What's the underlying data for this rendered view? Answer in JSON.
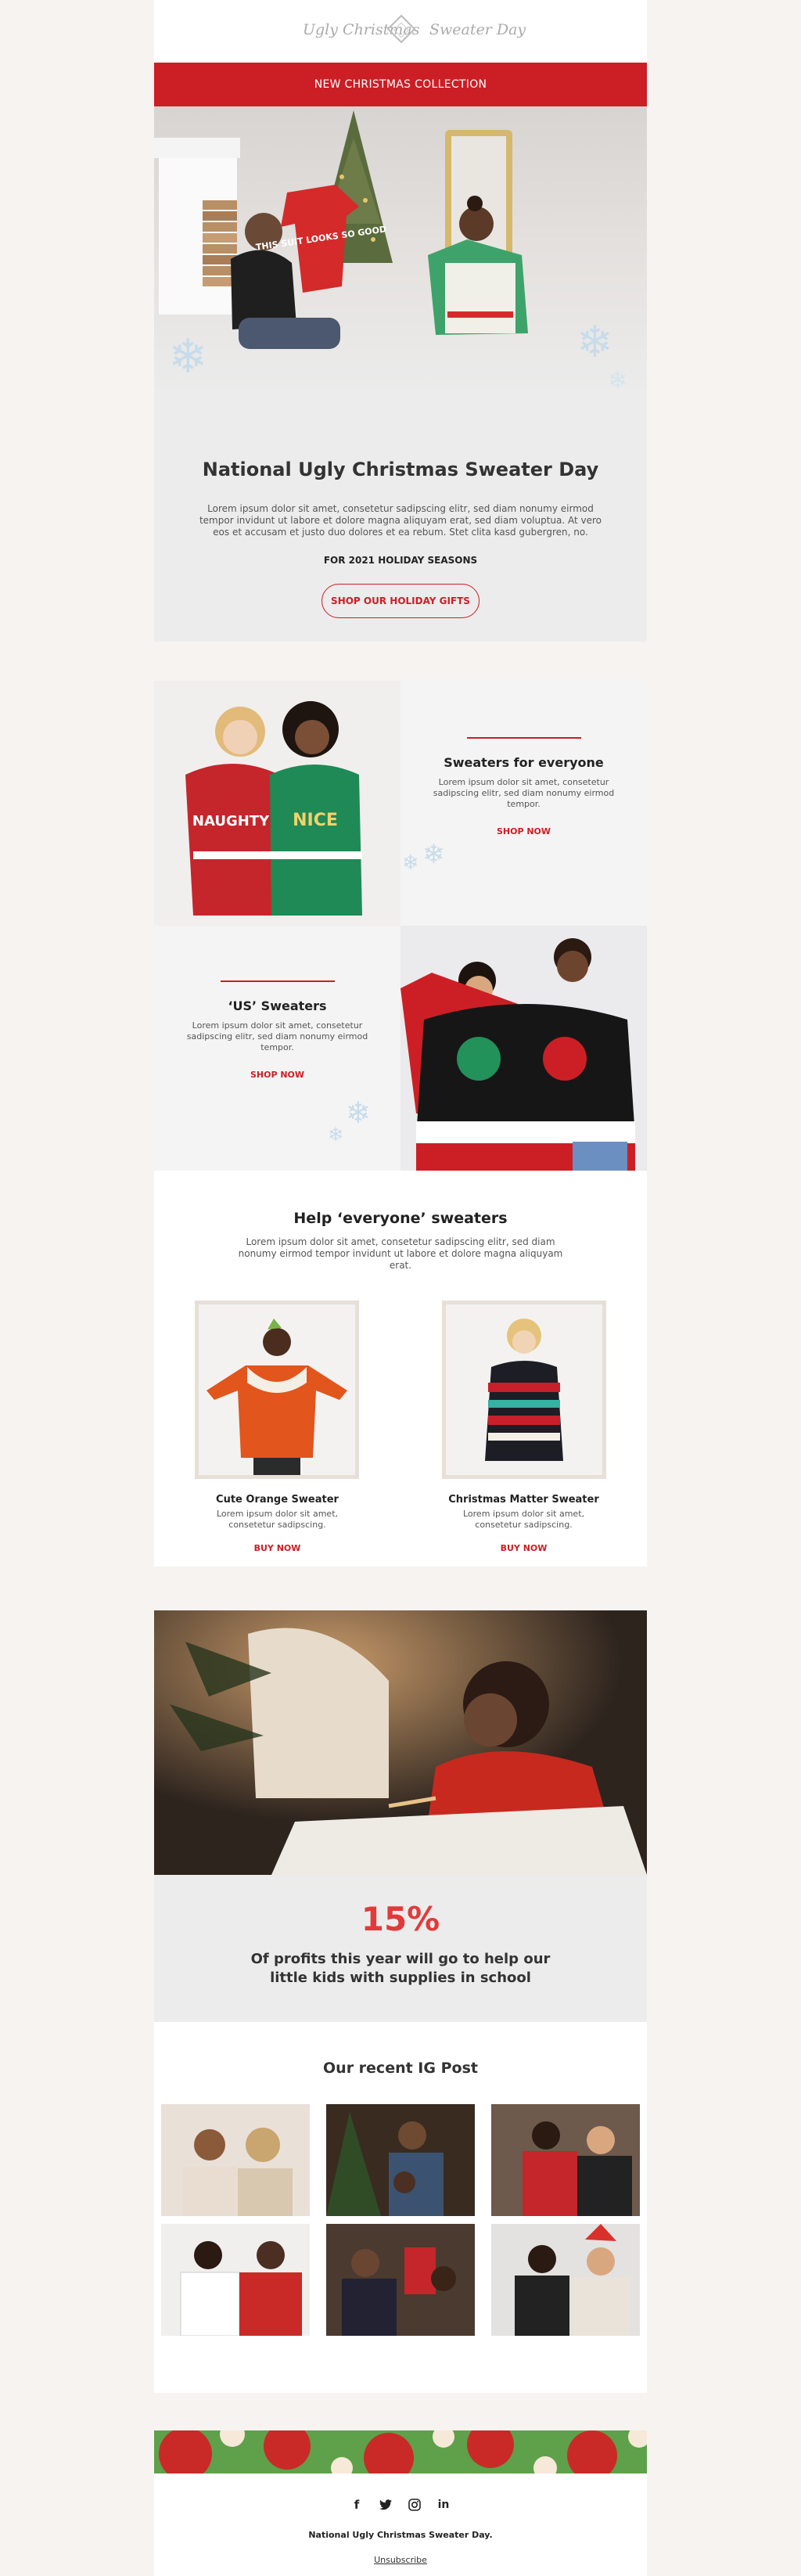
{
  "header": {
    "brand_left": "Ugly Christmas",
    "brand_right": "Sweater Day",
    "banner": "NEW CHRISTMAS COLLECTION"
  },
  "hero": {
    "title": "National Ugly Christmas Sweater Day",
    "text": "Lorem ipsum dolor sit amet, consetetur sadipscing elitr, sed diam nonumy eirmod tempor invidunt ut labore et dolore magna aliquyam erat, sed diam voluptua. At vero eos et accusam et justo duo dolores et ea rebum. Stet clita kasd gubergren, no.",
    "subtitle": "FOR 2021 HOLIDAY SEASONS",
    "cta": "SHOP OUR HOLIDAY GIFTS",
    "sweater_print": "THIS SUIT LOOKS SO GOOD"
  },
  "sections": [
    {
      "title": "Sweaters for everyone",
      "text": "Lorem ipsum dolor sit amet, consetetur sadipscing elitr, sed diam nonumy eirmod tempor.",
      "link": "SHOP NOW"
    },
    {
      "title": "‘US’ Sweaters",
      "text": "Lorem ipsum dolor sit amet, consetetur sadipscing elitr, sed diam nonumy eirmod tempor.",
      "link": "SHOP NOW"
    }
  ],
  "photo_text": {
    "naughty": "NAUGHTY",
    "nice": "NICE"
  },
  "help": {
    "title": "Help ‘everyone’ sweaters",
    "text": "Lorem ipsum dolor sit amet, consetetur sadipscing elitr, sed diam nonumy eirmod tempor invidunt ut labore et dolore magna aliquyam erat.",
    "products": [
      {
        "name": "Cute Orange Sweater",
        "desc": "Lorem ipsum dolor sit amet, consetetur sadipscing.",
        "link": "BUY NOW"
      },
      {
        "name": "Christmas Matter Sweater",
        "desc": "Lorem ipsum dolor sit amet, consetetur sadipscing.",
        "link": "BUY NOW"
      }
    ]
  },
  "kids": {
    "percent": "15%",
    "text": "Of profits this year will go to help our little kids with supplies in school"
  },
  "ig": {
    "title": "Our recent IG Post"
  },
  "footer": {
    "social": [
      "facebook-icon",
      "twitter-icon",
      "instagram-icon",
      "linkedin-icon"
    ],
    "brand": "National Ugly Christmas Sweater Day.",
    "unsubscribe": "Unsubscribe"
  },
  "colors": {
    "accent": "#cc1e25",
    "percent": "#e23a3a",
    "panel": "#ececec"
  }
}
